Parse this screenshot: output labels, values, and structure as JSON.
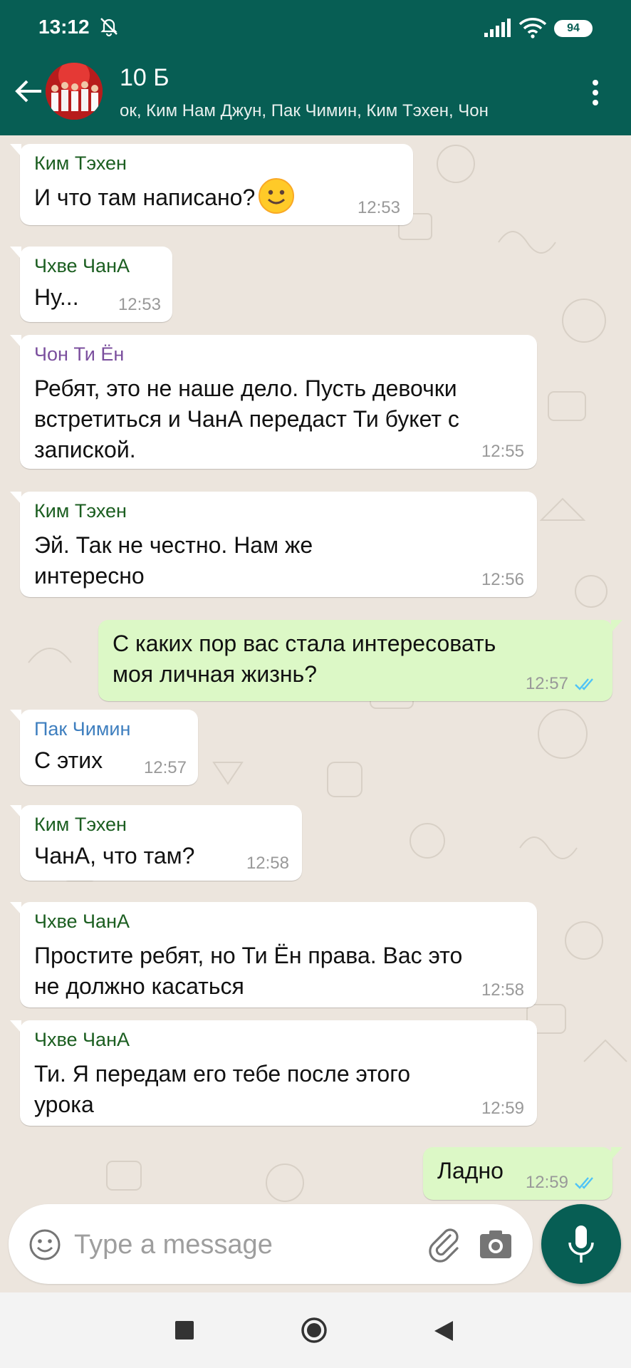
{
  "status_bar": {
    "time": "13:12",
    "battery": "94"
  },
  "header": {
    "title": "10 Б",
    "members": "ок, Ким Нам Джун, Пак Чимин, Ким Тэхен, Чон"
  },
  "messages": [
    {
      "sender": "Ким Тэхен",
      "sender_color": "#1b5e20",
      "lines": [
        "И что там написано?"
      ],
      "emoji": "slightly-smiling-face",
      "time": "12:53"
    },
    {
      "sender": "Чхве ЧанА",
      "sender_color": "#1b5e20",
      "lines": [
        "Ну..."
      ],
      "time": "12:53"
    },
    {
      "sender": "Чон Ти Ён",
      "sender_color": "#7b4f9e",
      "lines": [
        "Ребят, это не наше дело. Пусть девочки",
        "встретиться и ЧанА передаст Ти букет с",
        "запиской."
      ],
      "time": "12:55"
    },
    {
      "sender": "Ким Тэхен",
      "sender_color": "#1b5e20",
      "lines": [
        "Эй. Так не честно. Нам же",
        "интересно"
      ],
      "time": "12:56"
    },
    {
      "lines": [
        "С каких пор вас стала интересовать",
        "моя личная жизнь?"
      ],
      "time": "12:57",
      "status": "read"
    },
    {
      "sender": "Пак Чимин",
      "sender_color": "#3f7fbf",
      "lines": [
        "С этих"
      ],
      "time": "12:57"
    },
    {
      "sender": "Ким Тэхен",
      "sender_color": "#1b5e20",
      "lines": [
        "ЧанА, что там?"
      ],
      "time": "12:58"
    },
    {
      "sender": "Чхве ЧанА",
      "sender_color": "#1b5e20",
      "lines": [
        "Простите ребят, но Ти Ён права. Вас это",
        "не должно касаться"
      ],
      "time": "12:58"
    },
    {
      "sender": "Чхве ЧанА",
      "sender_color": "#1b5e20",
      "lines": [
        "Ти. Я передам его тебе после этого",
        "урока"
      ],
      "time": "12:59"
    },
    {
      "lines": [
        "Ладно"
      ],
      "time": "12:59",
      "status": "read"
    }
  ],
  "composer": {
    "placeholder": "Type a message"
  },
  "colors": {
    "brand": "#075e54",
    "outgoing": "#dcf8c6",
    "ticks": "#4fc3f7"
  }
}
